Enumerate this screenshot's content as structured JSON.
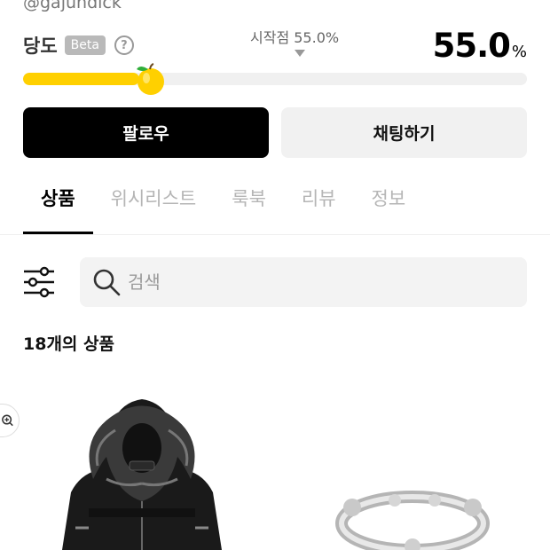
{
  "profile": {
    "username": "@gajundick"
  },
  "sweetness": {
    "label": "당도",
    "badge": "Beta",
    "help": "?",
    "start_label": "시작점 55.0%",
    "value": "55.0",
    "unit": "%",
    "level_percent": 23
  },
  "actions": {
    "follow": "팔로우",
    "chat": "채팅하기"
  },
  "tabs": [
    {
      "label": "상품",
      "active": true
    },
    {
      "label": "위시리스트",
      "active": false
    },
    {
      "label": "룩북",
      "active": false
    },
    {
      "label": "리뷰",
      "active": false
    },
    {
      "label": "정보",
      "active": false
    }
  ],
  "search": {
    "placeholder": "검색",
    "value": ""
  },
  "product_count": "18개의 상품",
  "products": [
    {
      "image": "black-fur-hood-leather-jacket"
    },
    {
      "image": "silver-bone-ring"
    }
  ],
  "colors": {
    "accent": "#ffd000",
    "primary_button": "#000000",
    "secondary_button": "#f1f1f1"
  }
}
